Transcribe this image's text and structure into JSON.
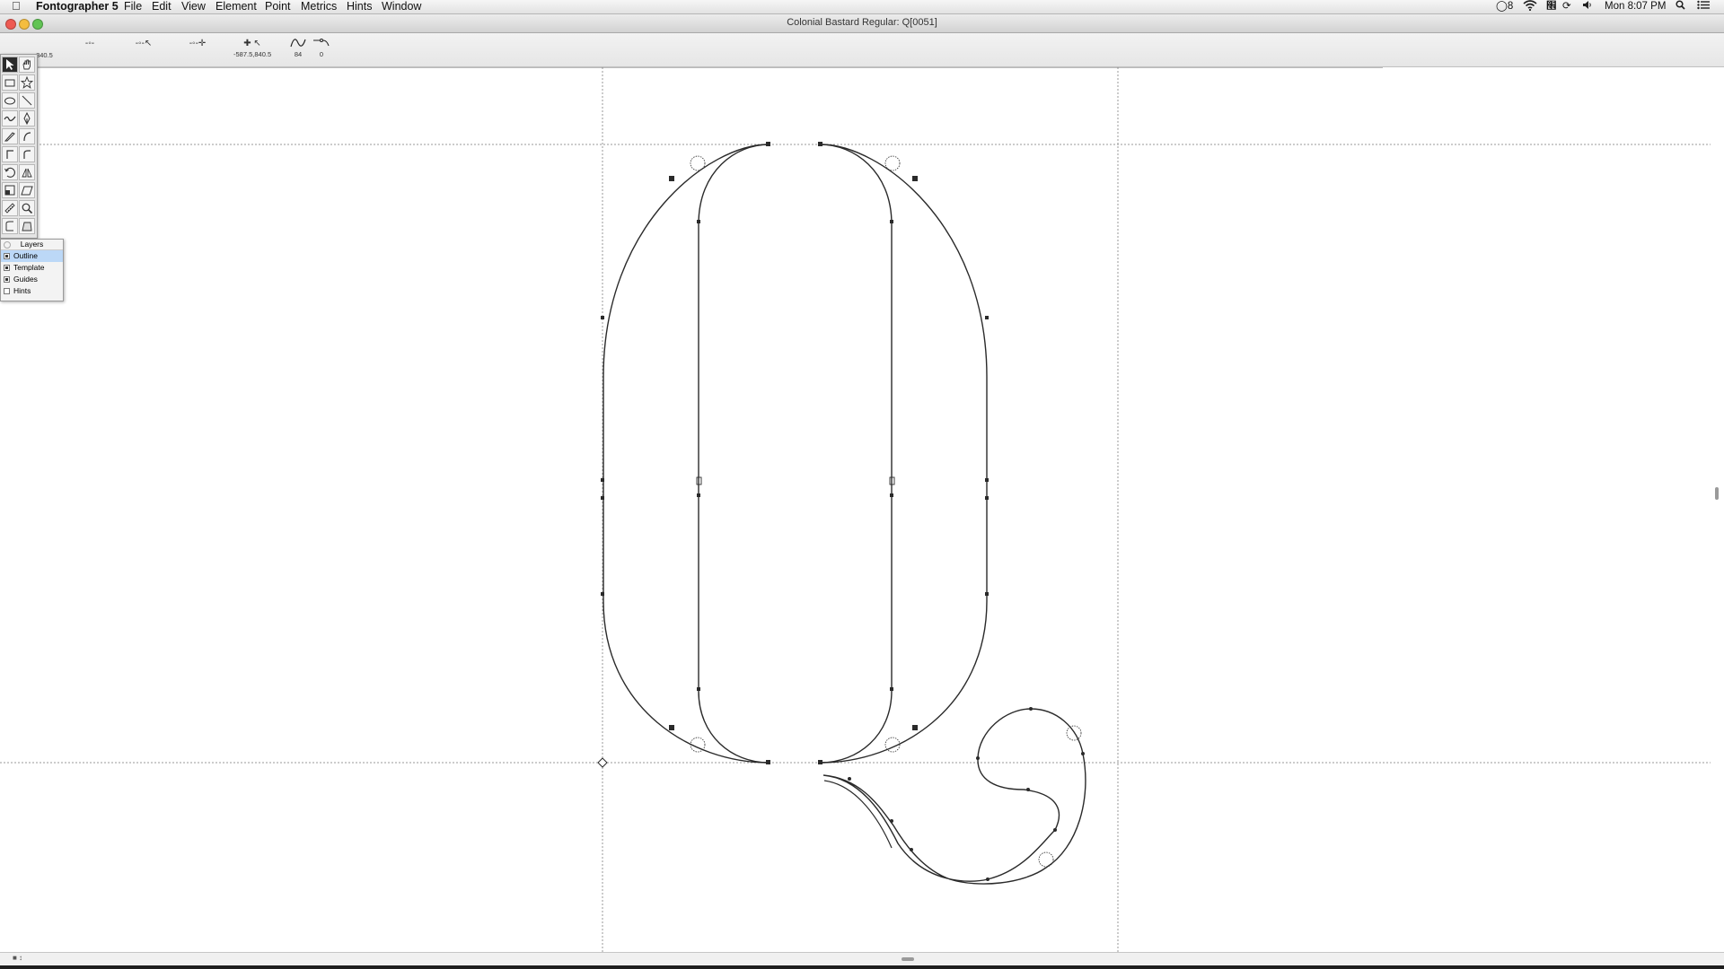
{
  "menubar": {
    "app_name": "Fontographer 5",
    "items": [
      "File",
      "Edit",
      "View",
      "Element",
      "Point",
      "Metrics",
      "Hints",
      "Window"
    ],
    "status": {
      "battery": "8",
      "clock": "Mon 8:07 PM"
    }
  },
  "window": {
    "title": "Colonial Bastard Regular: Q[0051]"
  },
  "toolbar": {
    "first_value": ".840.5",
    "tools": [
      {
        "icon": "point-icon",
        "value": ""
      },
      {
        "icon": "point-cursor-icon",
        "value": ""
      },
      {
        "icon": "point-add-icon",
        "value": ""
      },
      {
        "icon": "coordinates-icon",
        "value": "-587.5,840.5"
      },
      {
        "icon": "curve-icon",
        "value": "84"
      },
      {
        "icon": "smooth-icon",
        "value": "0"
      }
    ]
  },
  "tools_palette": {
    "selected": "pointer-tool"
  },
  "layers": {
    "title": "Layers",
    "items": [
      {
        "label": "Outline",
        "visible": true,
        "selected": true
      },
      {
        "label": "Template",
        "visible": true,
        "selected": false
      },
      {
        "label": "Guides",
        "visible": true,
        "selected": false
      },
      {
        "label": "Hints",
        "visible": false,
        "selected": false
      }
    ]
  },
  "colors": {
    "canvas_bg": "#ffffff",
    "outline": "#2a2a2a",
    "guide": "#9a9a9a",
    "selection": "#bcd8f7"
  }
}
